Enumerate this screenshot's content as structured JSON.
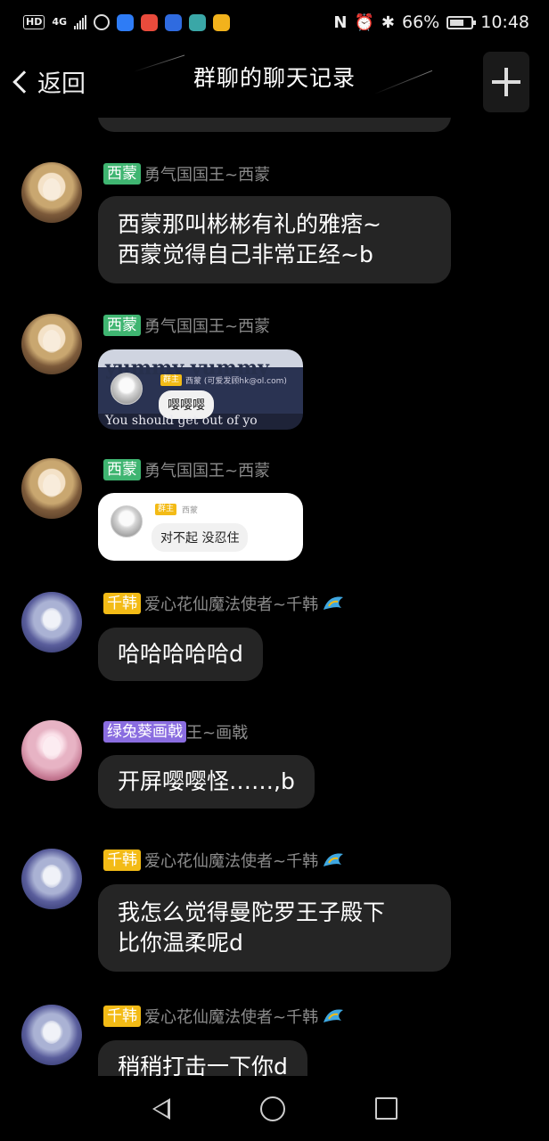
{
  "status_bar": {
    "hd": "HD",
    "network": "4G",
    "battery_percent": "66%",
    "battery_level": 0.66,
    "time": "10:48"
  },
  "header": {
    "back_label": "返回",
    "title": "群聊的聊天记录"
  },
  "messages": [
    {
      "tag": "西蒙",
      "nick": "勇气国国王~西蒙",
      "text_lines": [
        "西蒙那叫彬彬有礼的雅痞~",
        "西蒙觉得自己非常正经~b"
      ]
    },
    {
      "tag": "西蒙",
      "nick": "勇气国国王~西蒙",
      "sticker": {
        "title": "yummy yummy",
        "foot": "You should get out of yo",
        "mini_tag": "群主",
        "mini_name": "西蒙 (可爱发顾hk@ol.com)",
        "mini_text": "嘤嘤嘤"
      }
    },
    {
      "tag": "西蒙",
      "nick": "勇气国国王~西蒙",
      "sticker": {
        "mini_tag": "群主",
        "mini_name": "西蒙",
        "mini_text": "对不起 没忍住"
      }
    },
    {
      "tag": "千韩",
      "nick": "爱心花仙魔法使者~千韩",
      "text": "哈哈哈哈哈d"
    },
    {
      "tag": "绿兔葵画戟",
      "nick": "王~画戟",
      "text": "开屏嘤嘤怪……,b"
    },
    {
      "tag": "千韩",
      "nick": "爱心花仙魔法使者~千韩",
      "text_lines": [
        "我怎么觉得曼陀罗王子殿下",
        "比你温柔呢d"
      ]
    },
    {
      "tag": "千韩",
      "nick": "爱心花仙魔法使者~千韩",
      "text": "稍稍打击一下你d"
    }
  ],
  "colors": {
    "background": "#000000",
    "bubble": "#252525",
    "tag_green": "#3fb571",
    "tag_yellow": "#f3bb16",
    "tag_purple": "#8a6de0",
    "nick": "#8c8c8c"
  }
}
